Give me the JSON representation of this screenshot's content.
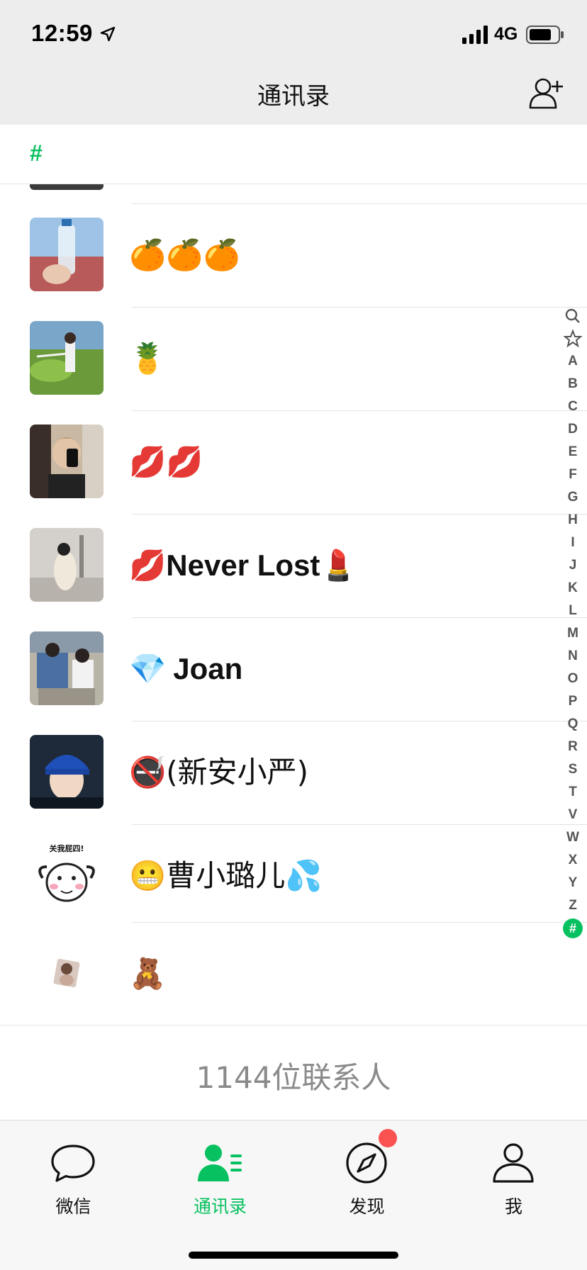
{
  "status_bar": {
    "time": "12:59",
    "network": "4G",
    "icons": [
      "location-arrow-icon",
      "signal-icon",
      "battery-icon"
    ]
  },
  "nav": {
    "title": "通讯录",
    "right_icon": "add-friend-icon"
  },
  "section": {
    "letter": "#"
  },
  "contacts": [
    {
      "name": "🍊🍊🍊"
    },
    {
      "name": "🍍"
    },
    {
      "name": "💋💋"
    },
    {
      "name_prefix": "💋",
      "name_text": "Never Lost",
      "name_suffix": "💄"
    },
    {
      "name_prefix": "💎",
      "name_text": "Joan"
    },
    {
      "name_prefix": "🚭",
      "name_text": "(新安小严)"
    },
    {
      "name_prefix": "😬",
      "name_text": "曹小璐儿",
      "name_suffix": "💦",
      "avatar_caption": "关我屁四!"
    },
    {
      "name": "🧸"
    }
  ],
  "index_bar": [
    "search",
    "star",
    "A",
    "B",
    "C",
    "D",
    "E",
    "F",
    "G",
    "H",
    "I",
    "J",
    "K",
    "L",
    "M",
    "N",
    "O",
    "P",
    "Q",
    "R",
    "S",
    "T",
    "V",
    "W",
    "X",
    "Y",
    "Z",
    "#"
  ],
  "index_active": "#",
  "footer": {
    "count_text": "1144位联系人"
  },
  "tabs": [
    {
      "label": "微信",
      "icon": "chat-bubble-icon"
    },
    {
      "label": "通讯录",
      "icon": "contacts-icon",
      "active": true
    },
    {
      "label": "发现",
      "icon": "compass-icon",
      "badge": true
    },
    {
      "label": "我",
      "icon": "person-icon"
    }
  ],
  "colors": {
    "accent": "#07c160",
    "badge": "#fa5151",
    "nav_bg": "#ededed"
  }
}
